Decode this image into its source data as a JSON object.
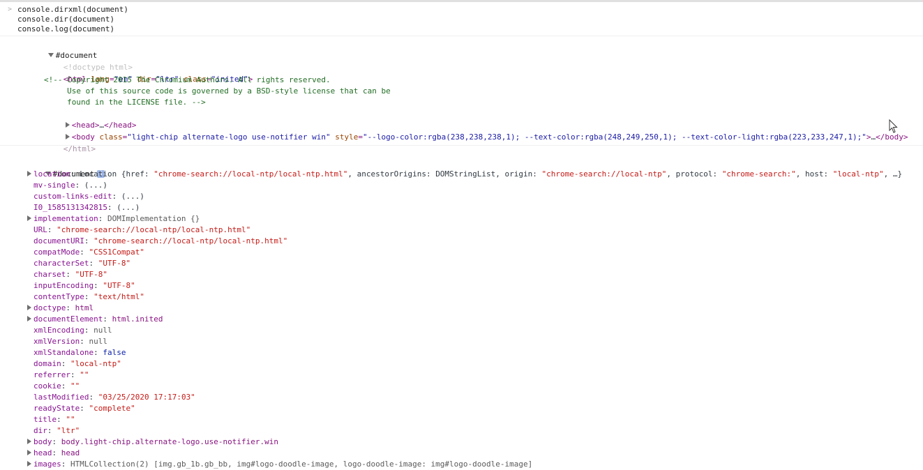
{
  "commands": [
    "console.dirxml(document)",
    "console.dir(document)",
    "console.log(document)"
  ],
  "dirxml": {
    "root_label": "#document",
    "doctype": "<!doctype html>",
    "html_open": {
      "tag_start": "<html",
      "lang_attr": " lang",
      "lang_val": "\"en\"",
      "dir_attr": " dir",
      "dir_val": "\"ltr\"",
      "class_attr": " class",
      "class_val": "\"inited\"",
      "tag_end": ">"
    },
    "comment_lines": [
      "<!-- Copyright 2015 The Chromium Authors. All rights reserved.",
      "     Use of this source code is governed by a BSD-style license that can be",
      "     found in the LICENSE file. -->"
    ],
    "head": {
      "open": "<head>",
      "ellipsis": "…",
      "close": "</head>"
    },
    "body": {
      "open": "<body",
      "class_attr": " class",
      "class_val": "\"light-chip alternate-logo use-notifier win\"",
      "style_attr": " style",
      "style_val": "\"--logo-color:rgba(238,238,238,1); --text-color:rgba(248,249,250,1); --text-color-light:rgba(223,233,247,1);\"",
      "end": ">",
      "ellipsis": "…",
      "close": "</body>"
    },
    "html_close": "</html>"
  },
  "dir": {
    "root_label": "#document",
    "info_icon": "info-icon",
    "props": [
      {
        "key": "location",
        "expandable": true,
        "parts": [
          {
            "t": "Location {href: ",
            "c": "plain"
          },
          {
            "t": "\"chrome-search://local-ntp/local-ntp.html\"",
            "c": "str"
          },
          {
            "t": ", ancestorOrigins: DOMStringList, origin: ",
            "c": "plain"
          },
          {
            "t": "\"chrome-search://local-ntp\"",
            "c": "str"
          },
          {
            "t": ", protocol: ",
            "c": "plain"
          },
          {
            "t": "\"chrome-search:\"",
            "c": "str"
          },
          {
            "t": ", host: ",
            "c": "plain"
          },
          {
            "t": "\"local-ntp\"",
            "c": "str"
          },
          {
            "t": ", …}",
            "c": "plain"
          }
        ]
      },
      {
        "key": "mv-single",
        "expandable": false,
        "parts": [
          {
            "t": "(...)",
            "c": "plain"
          }
        ]
      },
      {
        "key": "custom-links-edit",
        "expandable": false,
        "parts": [
          {
            "t": "(...)",
            "c": "plain"
          }
        ]
      },
      {
        "key": "I0_1585131342815",
        "expandable": false,
        "parts": [
          {
            "t": "(...)",
            "c": "plain"
          }
        ]
      },
      {
        "key": "implementation",
        "expandable": true,
        "parts": [
          {
            "t": "DOMImplementation {}",
            "c": "grey"
          }
        ]
      },
      {
        "key": "URL",
        "expandable": false,
        "parts": [
          {
            "t": "\"chrome-search://local-ntp/local-ntp.html\"",
            "c": "str"
          }
        ]
      },
      {
        "key": "documentURI",
        "expandable": false,
        "parts": [
          {
            "t": "\"chrome-search://local-ntp/local-ntp.html\"",
            "c": "str"
          }
        ]
      },
      {
        "key": "compatMode",
        "expandable": false,
        "parts": [
          {
            "t": "\"CSS1Compat\"",
            "c": "str"
          }
        ]
      },
      {
        "key": "characterSet",
        "expandable": false,
        "parts": [
          {
            "t": "\"UTF-8\"",
            "c": "str"
          }
        ]
      },
      {
        "key": "charset",
        "expandable": false,
        "parts": [
          {
            "t": "\"UTF-8\"",
            "c": "str"
          }
        ]
      },
      {
        "key": "inputEncoding",
        "expandable": false,
        "parts": [
          {
            "t": "\"UTF-8\"",
            "c": "str"
          }
        ]
      },
      {
        "key": "contentType",
        "expandable": false,
        "parts": [
          {
            "t": "\"text/html\"",
            "c": "str"
          }
        ]
      },
      {
        "key": "doctype",
        "expandable": true,
        "parts": [
          {
            "t": "html",
            "c": "tag"
          }
        ]
      },
      {
        "key": "documentElement",
        "expandable": true,
        "parts": [
          {
            "t": "html.inited",
            "c": "tag"
          }
        ]
      },
      {
        "key": "xmlEncoding",
        "expandable": false,
        "parts": [
          {
            "t": "null",
            "c": "grey"
          }
        ]
      },
      {
        "key": "xmlVersion",
        "expandable": false,
        "parts": [
          {
            "t": "null",
            "c": "grey"
          }
        ]
      },
      {
        "key": "xmlStandalone",
        "expandable": false,
        "parts": [
          {
            "t": "false",
            "c": "kw"
          }
        ]
      },
      {
        "key": "domain",
        "expandable": false,
        "parts": [
          {
            "t": "\"local-ntp\"",
            "c": "str"
          }
        ]
      },
      {
        "key": "referrer",
        "expandable": false,
        "parts": [
          {
            "t": "\"\"",
            "c": "str"
          }
        ]
      },
      {
        "key": "cookie",
        "expandable": false,
        "parts": [
          {
            "t": "\"\"",
            "c": "str"
          }
        ]
      },
      {
        "key": "lastModified",
        "expandable": false,
        "parts": [
          {
            "t": "\"03/25/2020 17:17:03\"",
            "c": "str"
          }
        ]
      },
      {
        "key": "readyState",
        "expandable": false,
        "parts": [
          {
            "t": "\"complete\"",
            "c": "str"
          }
        ]
      },
      {
        "key": "title",
        "expandable": false,
        "parts": [
          {
            "t": "\"\"",
            "c": "str"
          }
        ]
      },
      {
        "key": "dir",
        "expandable": false,
        "parts": [
          {
            "t": "\"ltr\"",
            "c": "str"
          }
        ]
      },
      {
        "key": "body",
        "expandable": true,
        "parts": [
          {
            "t": "body.light-chip.alternate-logo.use-notifier.win",
            "c": "tag"
          }
        ]
      },
      {
        "key": "head",
        "expandable": true,
        "parts": [
          {
            "t": "head",
            "c": "tag"
          }
        ]
      },
      {
        "key": "images",
        "expandable": true,
        "parts": [
          {
            "t": "HTMLCollection(2) [img.gb_1b.gb_bb, img#logo-doodle-image, logo-doodle-image: img#logo-doodle-image]",
            "c": "grey"
          }
        ]
      }
    ]
  }
}
